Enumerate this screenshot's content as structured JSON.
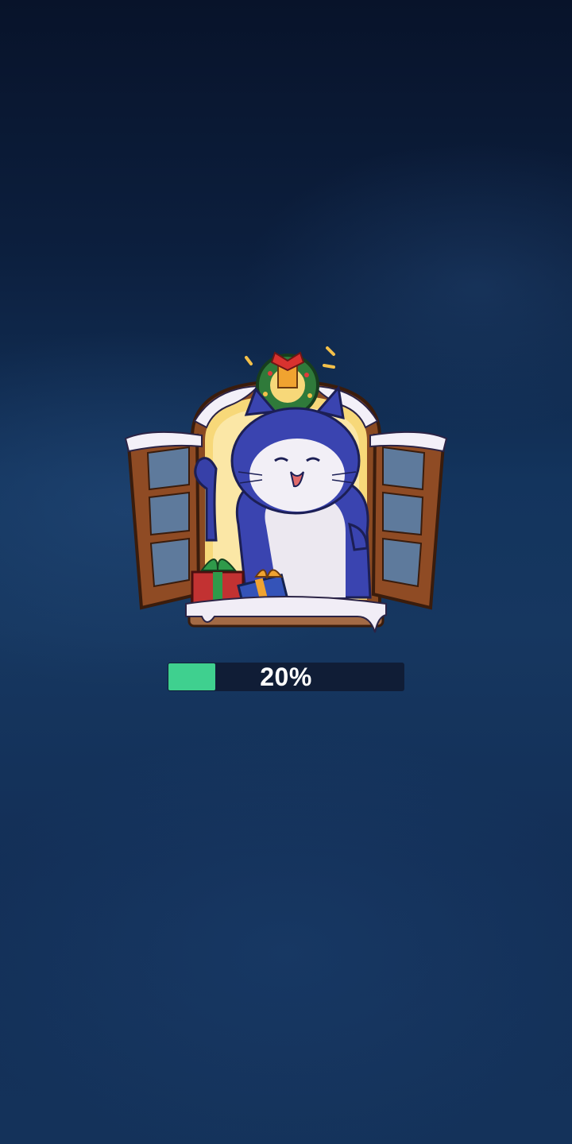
{
  "loading": {
    "progress_text": "20%",
    "progress_fraction": 0.2
  },
  "colors": {
    "background_top": "#08132a",
    "background_bottom": "#14325a",
    "progress_track": "#101d36",
    "progress_fill": "#3fd08f",
    "progress_text": "#ffffff"
  },
  "artwork": {
    "icon": "cat-in-christmas-window-illustration"
  }
}
